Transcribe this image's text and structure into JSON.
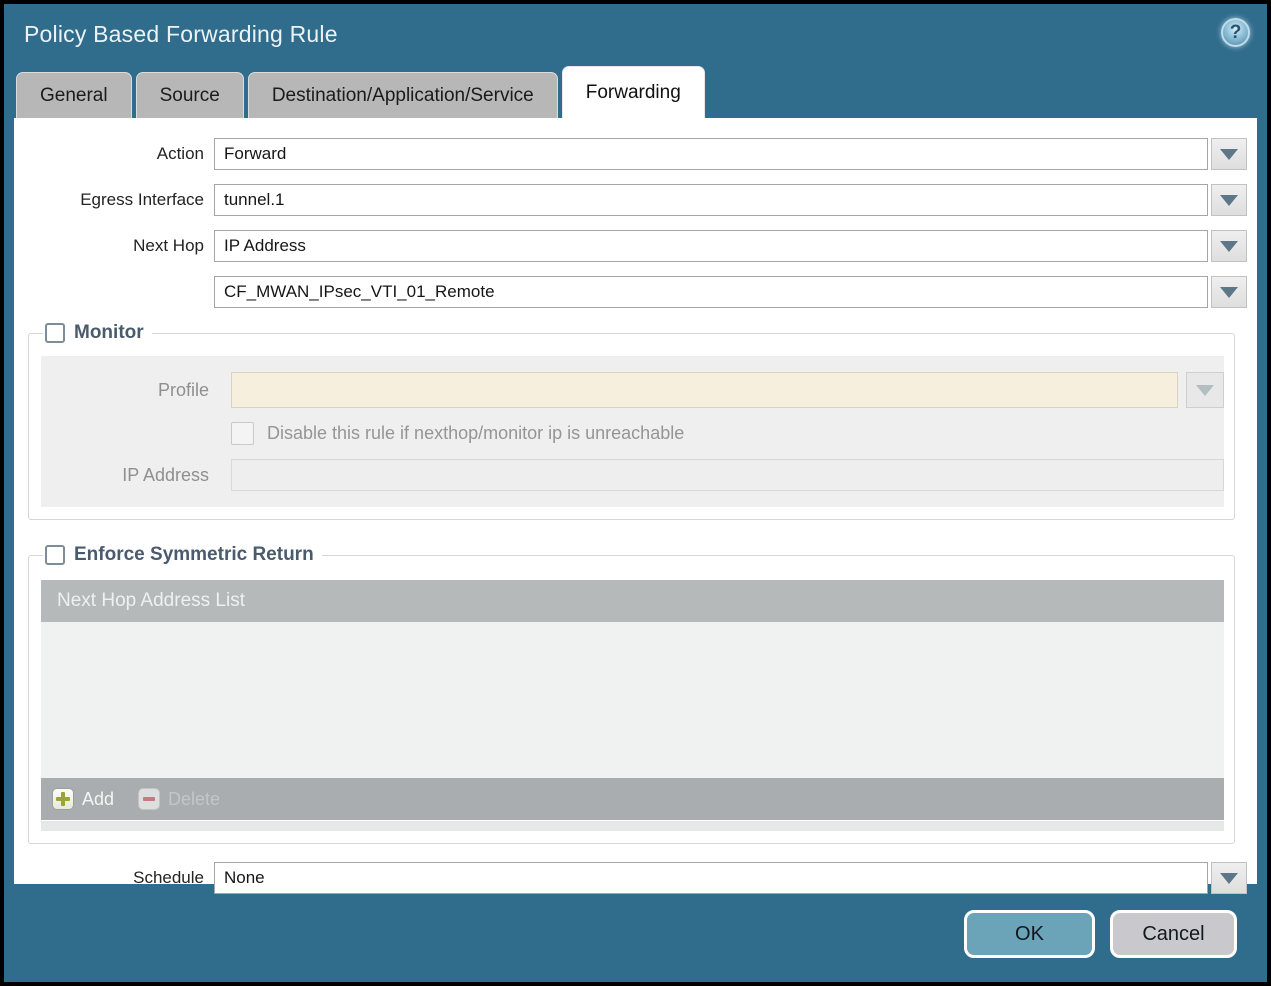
{
  "window": {
    "title": "Policy Based Forwarding Rule",
    "help_glyph": "?"
  },
  "tabs": [
    {
      "label": "General",
      "active": false
    },
    {
      "label": "Source",
      "active": false
    },
    {
      "label": "Destination/Application/Service",
      "active": false
    },
    {
      "label": "Forwarding",
      "active": true
    }
  ],
  "form": {
    "action": {
      "label": "Action",
      "value": "Forward"
    },
    "egress_interface": {
      "label": "Egress Interface",
      "value": "tunnel.1"
    },
    "next_hop": {
      "label": "Next Hop",
      "value": "IP Address"
    },
    "next_hop_address": {
      "value": "CF_MWAN_IPsec_VTI_01_Remote"
    },
    "schedule": {
      "label": "Schedule",
      "value": "None"
    }
  },
  "monitor": {
    "legend": "Monitor",
    "checked": false,
    "profile": {
      "label": "Profile",
      "value": ""
    },
    "disable_rule": {
      "label": "Disable this rule if nexthop/monitor ip is unreachable",
      "checked": false
    },
    "ip_address": {
      "label": "IP Address",
      "value": ""
    }
  },
  "enforce_symmetric_return": {
    "legend": "Enforce Symmetric Return",
    "checked": false,
    "table": {
      "header": "Next Hop Address List",
      "rows": []
    },
    "add_label": "Add",
    "delete_label": "Delete",
    "delete_enabled": false
  },
  "footer": {
    "ok_label": "OK",
    "cancel_label": "Cancel"
  },
  "colors": {
    "frame": "#306C8C",
    "ok_button": "#6BA3B9",
    "cancel_button": "#C9C9CD",
    "legend_text": "#4A5B6D",
    "profile_disabled_bg": "#F6EFDE",
    "table_header_bg": "#B5B9BA",
    "table_footer_bg": "#A9ADB0",
    "add_plus": "#99A636",
    "delete_minus": "#C57A80"
  }
}
